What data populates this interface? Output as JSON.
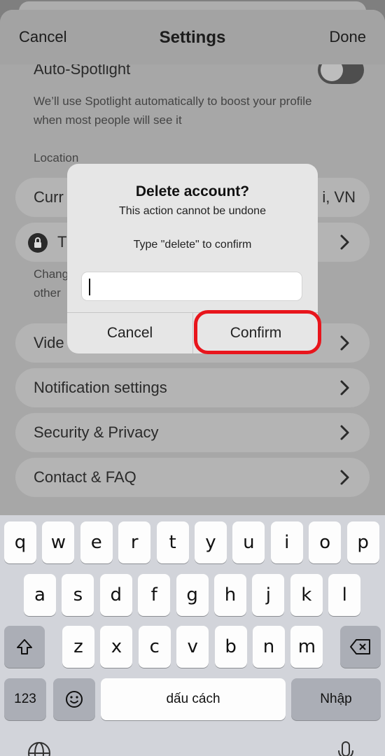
{
  "navbar": {
    "cancel": "Cancel",
    "title": "Settings",
    "done": "Done"
  },
  "settings": {
    "auto_spotlight": {
      "label": "Auto-Spotlight",
      "toggle_on": false
    },
    "auto_spotlight_note": [
      "We’ll use Spotlight automatically to boost your profile",
      "when most people will see it"
    ],
    "location_header": "Location",
    "current_location": {
      "label": "Curr",
      "value": "i, VN"
    },
    "travel": {
      "label": "T"
    },
    "change_note": [
      "Chang",
      "other"
    ],
    "video": {
      "label": "Vide"
    },
    "notification": {
      "label": "Notification settings"
    },
    "security": {
      "label": "Security & Privacy"
    },
    "contact": {
      "label": "Contact & FAQ"
    }
  },
  "dialog": {
    "title": "Delete account?",
    "subtitle": "This action cannot be undone",
    "prompt": "Type \"delete\" to confirm",
    "input_value": "",
    "cancel": "Cancel",
    "confirm": "Confirm"
  },
  "keyboard": {
    "row1": [
      "q",
      "w",
      "e",
      "r",
      "t",
      "y",
      "u",
      "i",
      "o",
      "p"
    ],
    "row2": [
      "a",
      "s",
      "d",
      "f",
      "g",
      "h",
      "j",
      "k",
      "l"
    ],
    "row3": [
      "z",
      "x",
      "c",
      "v",
      "b",
      "n",
      "m"
    ],
    "numbers": "123",
    "space": "dấu cách",
    "return": "Nhập"
  },
  "colors": {
    "highlight": "#e8151c",
    "dim_overlay": "#7f7f7f"
  }
}
